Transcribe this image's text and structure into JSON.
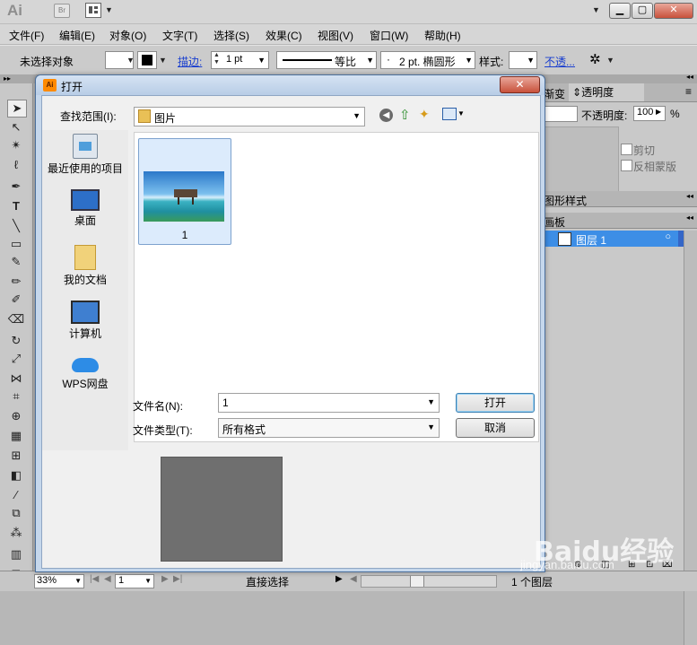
{
  "app": {
    "logo": "Ai",
    "bridge_badge": "Br"
  },
  "menu": [
    "文件(F)",
    "编辑(E)",
    "对象(O)",
    "文字(T)",
    "选择(S)",
    "效果(C)",
    "视图(V)",
    "窗口(W)",
    "帮助(H)"
  ],
  "control": {
    "selection_label": "未选择对象",
    "stroke_label": "描边:",
    "stroke_value": "1 pt",
    "profile_label": "等比",
    "brush_label": "2 pt. 椭圆形",
    "style_label": "样式:",
    "opacity_link": "不透..."
  },
  "dialog": {
    "title": "打开",
    "lookin_label": "查找范围(I):",
    "lookin_value": "图片",
    "places": [
      "最近使用的项目",
      "桌面",
      "我的文档",
      "计算机",
      "WPS网盘"
    ],
    "file_item": "1",
    "filename_label": "文件名(N):",
    "filename_value": "1",
    "filetype_label": "文件类型(T):",
    "filetype_value": "所有格式",
    "open_button": "打开",
    "cancel_button": "取消"
  },
  "panels": {
    "tab_gradient": "渐变",
    "tab_transparency": "透明度",
    "opacity_label": "不透明度:",
    "opacity_value": "100",
    "opacity_unit": "%",
    "clip_label": "剪切",
    "invert_label": "反相蒙版",
    "graphic_styles": "图形样式",
    "layers_tab": "画板",
    "layer_name": "图层 1"
  },
  "status": {
    "zoom": "33%",
    "artboard": "1",
    "tool": "直接选择",
    "layers_count": "1 个图层"
  },
  "watermark": {
    "brand": "Baidu经验",
    "url": "jingyan.baidu.com"
  },
  "colors": {
    "accent": "#1a3fcf",
    "layer_highlight": "#3d8ee6"
  }
}
